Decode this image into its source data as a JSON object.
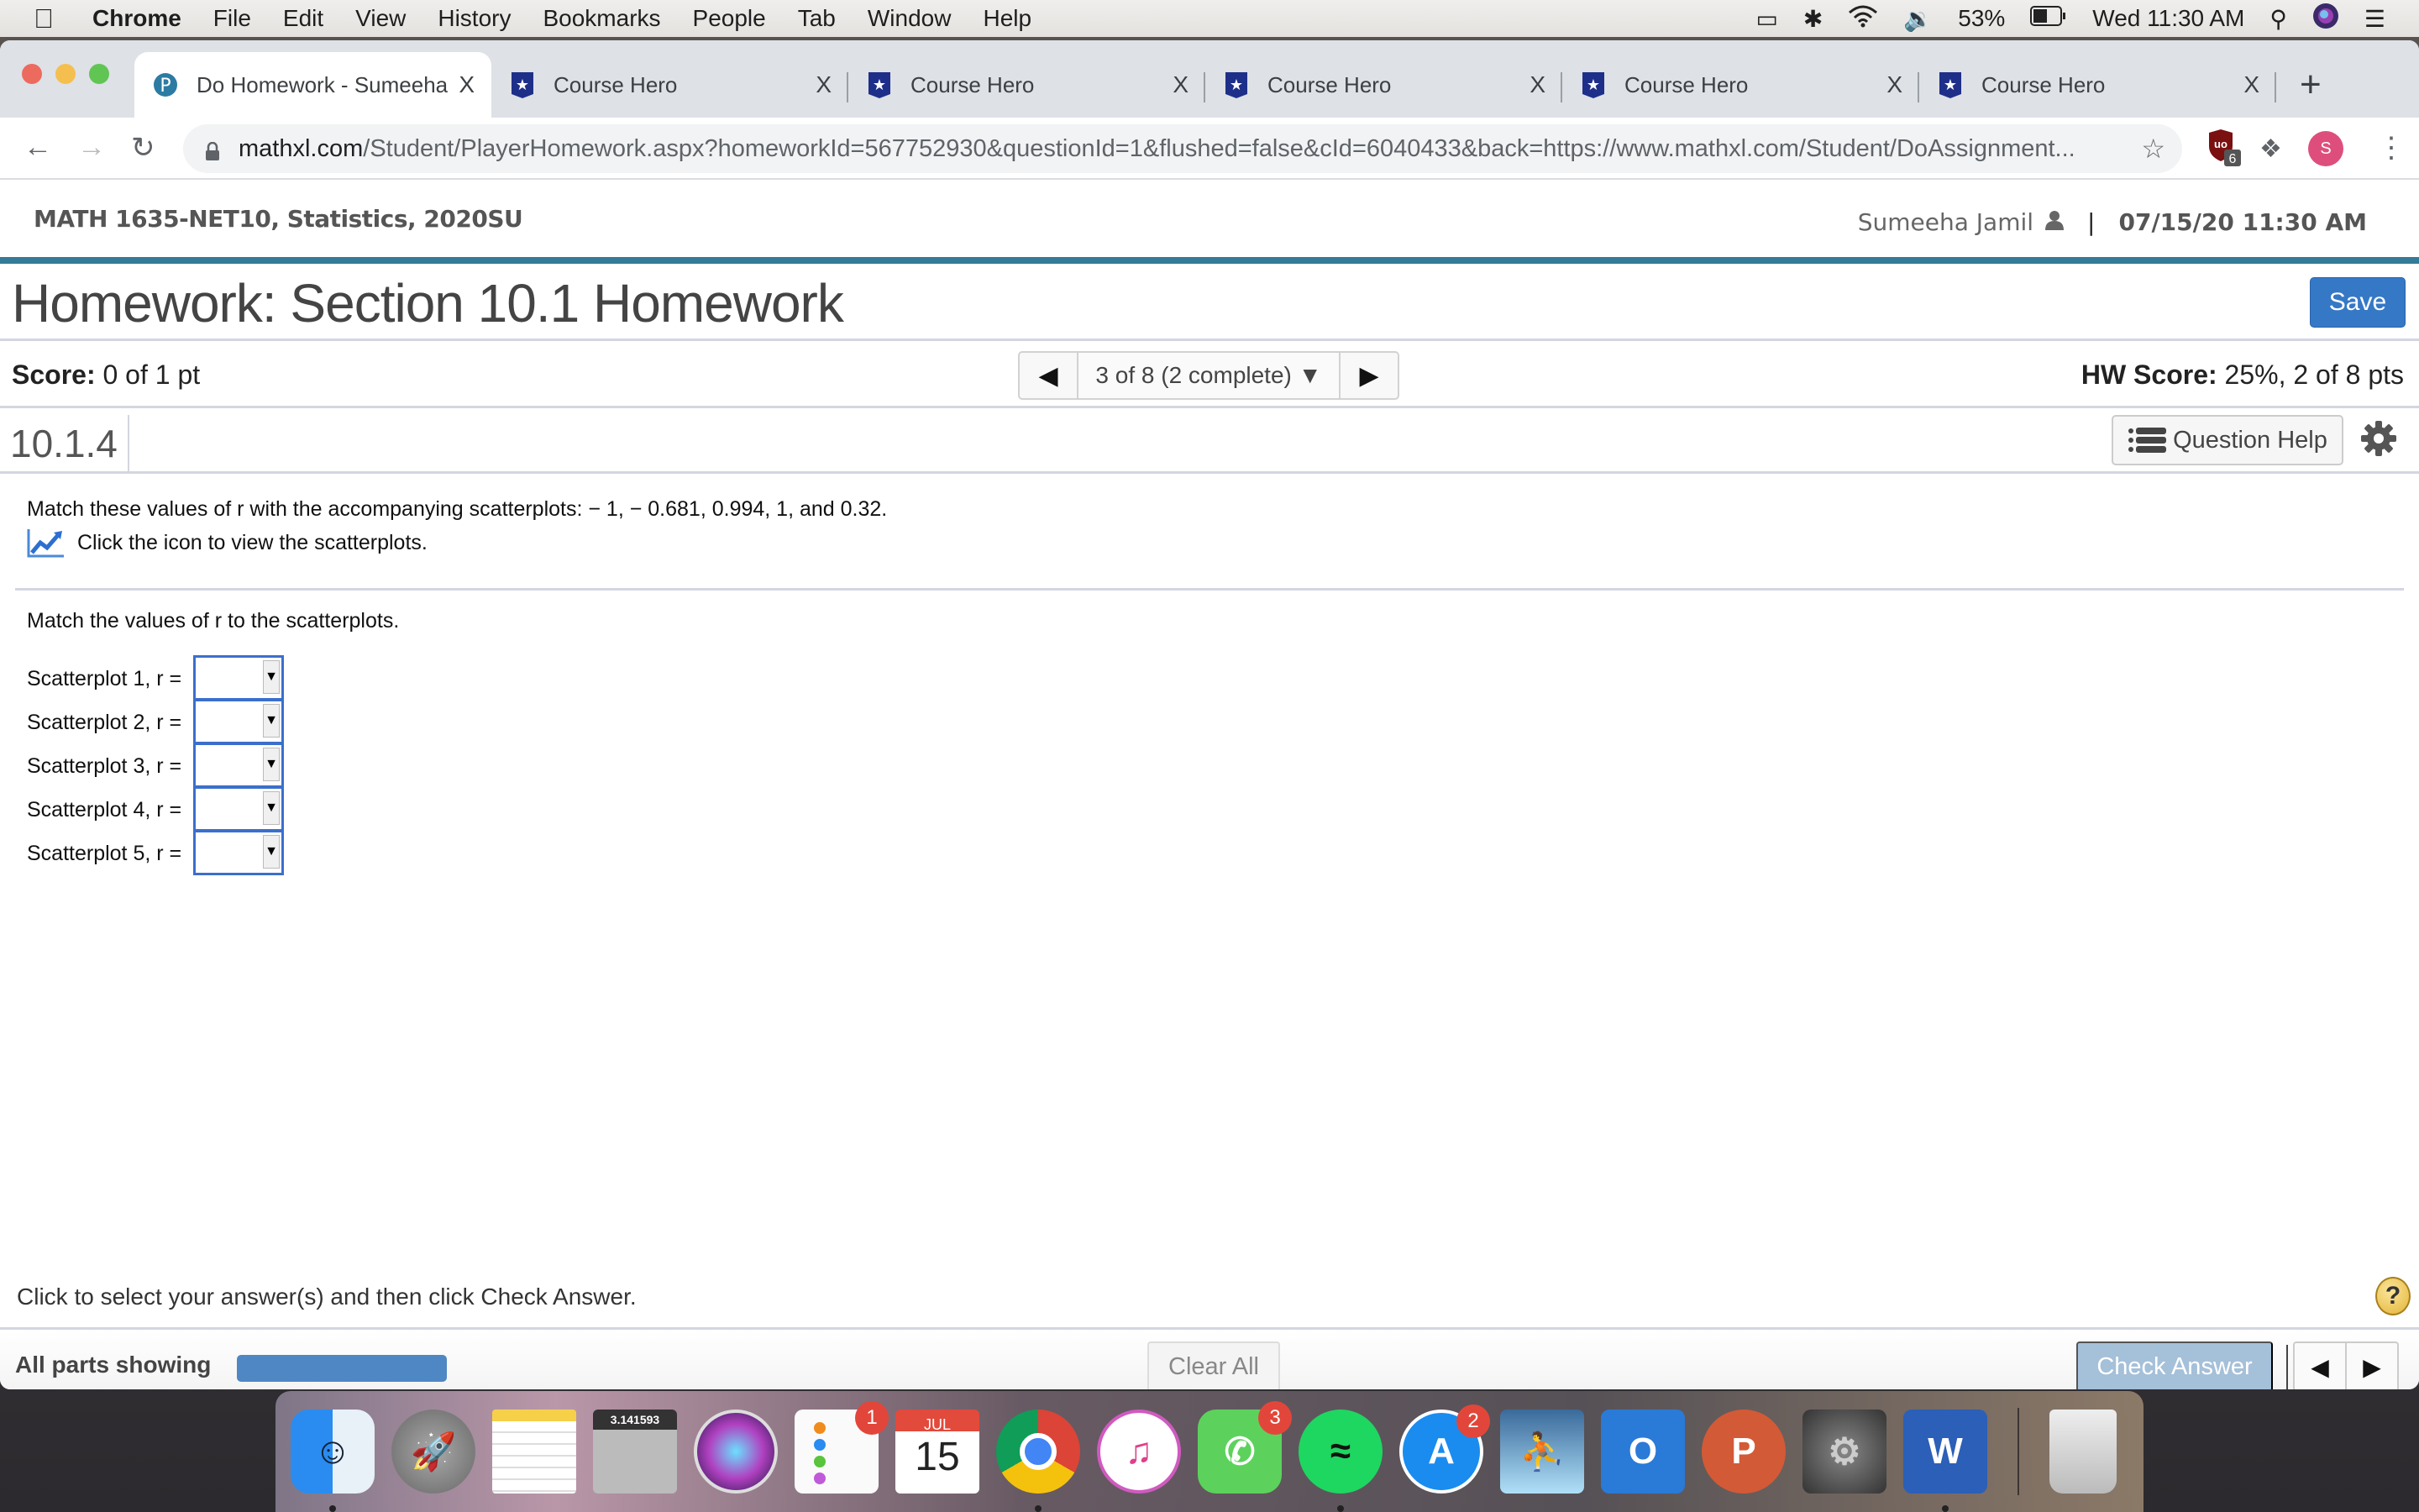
{
  "menubar": {
    "app_name": "Chrome",
    "items": [
      "File",
      "Edit",
      "View",
      "History",
      "Bookmarks",
      "People",
      "Tab",
      "Window",
      "Help"
    ],
    "battery": "53%",
    "clock": "Wed 11:30 AM"
  },
  "browser": {
    "tabs": [
      {
        "title": "Do Homework - Sumeeha Jamil",
        "favicon": "pearson-icon",
        "active": true
      },
      {
        "title": "Course Hero",
        "favicon": "course-hero-icon",
        "active": false
      },
      {
        "title": "Course Hero",
        "favicon": "course-hero-icon",
        "active": false
      },
      {
        "title": "Course Hero",
        "favicon": "course-hero-icon",
        "active": false
      },
      {
        "title": "Course Hero",
        "favicon": "course-hero-icon",
        "active": false
      },
      {
        "title": "Course Hero",
        "favicon": "course-hero-icon",
        "active": false
      }
    ],
    "close_glyph": "X",
    "new_tab_glyph": "+",
    "url_domain": "mathxl.com",
    "url_path": "/Student/PlayerHomework.aspx?homeworkId=567752930&questionId=1&flushed=false&cId=6040433&back=https://www.mathxl.com/Student/DoAssignment...",
    "extension_badge": "6",
    "profile_initial": "S"
  },
  "course": {
    "title": "MATH 1635-NET10, Statistics, 2020SU",
    "user": "Sumeeha Jamil",
    "separator": "|",
    "datetime": "07/15/20 11:30 AM"
  },
  "homework": {
    "title": "Homework: Section 10.1 Homework",
    "save_label": "Save",
    "score_label": "Score:",
    "score_value": "0 of 1 pt",
    "question_nav": "3 of 8 (2 complete)",
    "hw_score_label": "HW Score:",
    "hw_score_value": "25%, 2 of 8 pts",
    "question_id": "10.1.4",
    "question_help_label": "Question Help"
  },
  "question": {
    "prompt": "Match these values of r with the accompanying scatterplots:  − 1,  − 0.681, 0.994, 1, and 0.32.",
    "icon_hint": "Click the icon to view the scatterplots.",
    "match_title": "Match the values of r to the scatterplots.",
    "rows": [
      {
        "label": "Scatterplot 1, r =",
        "value": ""
      },
      {
        "label": "Scatterplot 2, r =",
        "value": ""
      },
      {
        "label": "Scatterplot 3, r =",
        "value": ""
      },
      {
        "label": "Scatterplot 4, r =",
        "value": ""
      },
      {
        "label": "Scatterplot 5, r =",
        "value": ""
      }
    ],
    "r_options": [
      "-1",
      "-0.681",
      "0.994",
      "1",
      "0.32"
    ]
  },
  "footer": {
    "instruction": "Click to select your answer(s) and then click Check Answer.",
    "parts_label": "All parts showing",
    "progress": 1.0,
    "clear_all_label": "Clear All",
    "check_answer_label": "Check Answer",
    "help_glyph": "?"
  },
  "dock": {
    "apps": [
      {
        "name": "Finder",
        "badge": null,
        "running": true
      },
      {
        "name": "Launchpad",
        "badge": null,
        "running": false
      },
      {
        "name": "Notes",
        "badge": null,
        "running": false
      },
      {
        "name": "Calculator",
        "badge": null,
        "running": false,
        "display": "3.141593"
      },
      {
        "name": "Siri",
        "badge": null,
        "running": false
      },
      {
        "name": "Reminders",
        "badge": "1",
        "running": false
      },
      {
        "name": "Calendar",
        "badge": null,
        "running": false,
        "month": "JUL",
        "day": "15"
      },
      {
        "name": "Chrome",
        "badge": null,
        "running": true
      },
      {
        "name": "iTunes",
        "badge": null,
        "running": false
      },
      {
        "name": "FaceTime",
        "badge": "3",
        "running": false
      },
      {
        "name": "Spotify",
        "badge": null,
        "running": true
      },
      {
        "name": "App Store",
        "badge": "2",
        "running": false
      },
      {
        "name": "Kindle",
        "badge": null,
        "running": false
      },
      {
        "name": "Outlook",
        "badge": null,
        "running": false,
        "letter": "O"
      },
      {
        "name": "PowerPoint",
        "badge": null,
        "running": false,
        "letter": "P"
      },
      {
        "name": "System Preferences",
        "badge": null,
        "running": false
      },
      {
        "name": "Word",
        "badge": null,
        "running": true,
        "letter": "W"
      },
      {
        "name": "Trash",
        "badge": null,
        "running": false
      }
    ]
  }
}
